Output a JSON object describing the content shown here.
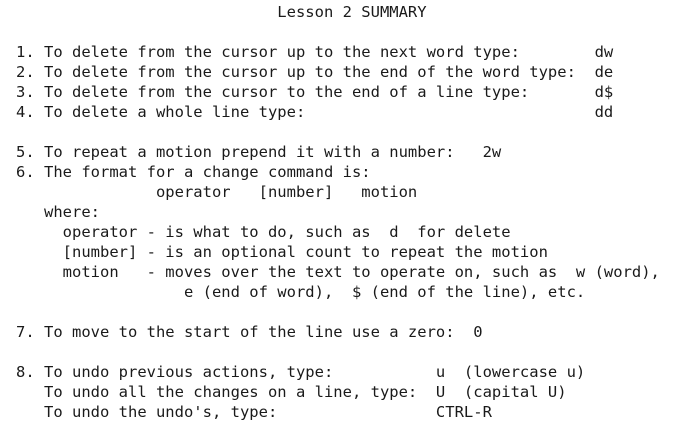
{
  "document": {
    "title": "                            Lesson 2 SUMMARY",
    "lines": [
      "",
      "",
      "1. To delete from the cursor up to the next word type:        dw",
      "2. To delete from the cursor up to the end of the word type:  de",
      "3. To delete from the cursor to the end of a line type:       d$",
      "4. To delete a whole line type:                               dd",
      "",
      "5. To repeat a motion prepend it with a number:   2w",
      "6. The format for a change command is:",
      "               operator   [number]   motion",
      "   where:",
      "     operator - is what to do, such as  d  for delete",
      "     [number] - is an optional count to repeat the motion",
      "     motion   - moves over the text to operate on, such as  w (word),",
      "                  e (end of word),  $ (end of the line), etc.",
      "",
      "7. To move to the start of the line use a zero:  0",
      "",
      "8. To undo previous actions, type:           u  (lowercase u)",
      "   To undo all the changes on a line, type:  U  (capital U)",
      "   To undo the undo's, type:                 CTRL-R"
    ]
  }
}
